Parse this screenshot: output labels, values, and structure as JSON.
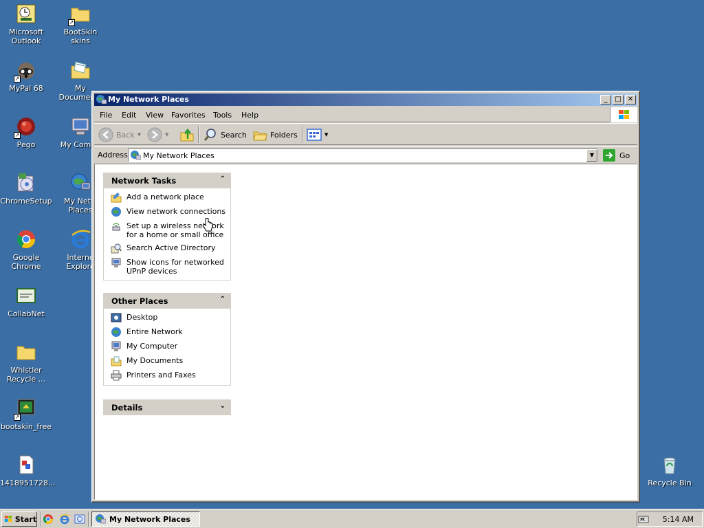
{
  "desktop": {
    "icons": [
      {
        "label": "Microsoft Outlook",
        "icon": "outlook-icon"
      },
      {
        "label": "BootSkin skins",
        "icon": "folder-icon"
      },
      {
        "label": "MyPal 68",
        "icon": "mypal-icon"
      },
      {
        "label": "My Documents",
        "icon": "my-documents-icon"
      },
      {
        "label": "Pego",
        "icon": "pego-icon"
      },
      {
        "label": "My Compu",
        "icon": "my-computer-icon"
      },
      {
        "label": "ChromeSetup",
        "icon": "chrome-setup-icon"
      },
      {
        "label": "My Netw Places",
        "icon": "network-places-icon"
      },
      {
        "label": "Google Chrome",
        "icon": "chrome-icon"
      },
      {
        "label": "Interne Explore",
        "icon": "internet-explorer-icon"
      },
      {
        "label": "CollabNet",
        "icon": "collabnet-icon"
      },
      {
        "label": "Whistler Recycle ...",
        "icon": "folder-icon"
      },
      {
        "label": "bootskin_free",
        "icon": "bootskin-icon"
      },
      {
        "label": "1418951728...",
        "icon": "document-icon"
      },
      {
        "label": "Recycle Bin",
        "icon": "recycle-bin-icon"
      }
    ]
  },
  "window": {
    "title": "My Network Places",
    "menu": [
      "File",
      "Edit",
      "View",
      "Favorites",
      "Tools",
      "Help"
    ],
    "toolbar": {
      "back": "Back",
      "search": "Search",
      "folders": "Folders"
    },
    "address": {
      "label": "Address",
      "value": "My Network Places",
      "go": "Go"
    },
    "network_tasks": {
      "title": "Network Tasks",
      "items": [
        "Add a network place",
        "View network connections",
        "Set up a wireless network for a home or small office",
        "Search Active Directory",
        "Show icons for networked UPnP devices"
      ]
    },
    "other_places": {
      "title": "Other Places",
      "items": [
        "Desktop",
        "Entire Network",
        "My Computer",
        "My Documents",
        "Printers and Faxes"
      ]
    },
    "details": {
      "title": "Details"
    }
  },
  "taskbar": {
    "start": "Start",
    "active_task": "My Network Places",
    "clock": "5:14 AM"
  },
  "colors": {
    "desktop": "#3a6ea5",
    "title_start": "#0a246a",
    "title_end": "#a6caf0",
    "face": "#d4d0c8"
  }
}
